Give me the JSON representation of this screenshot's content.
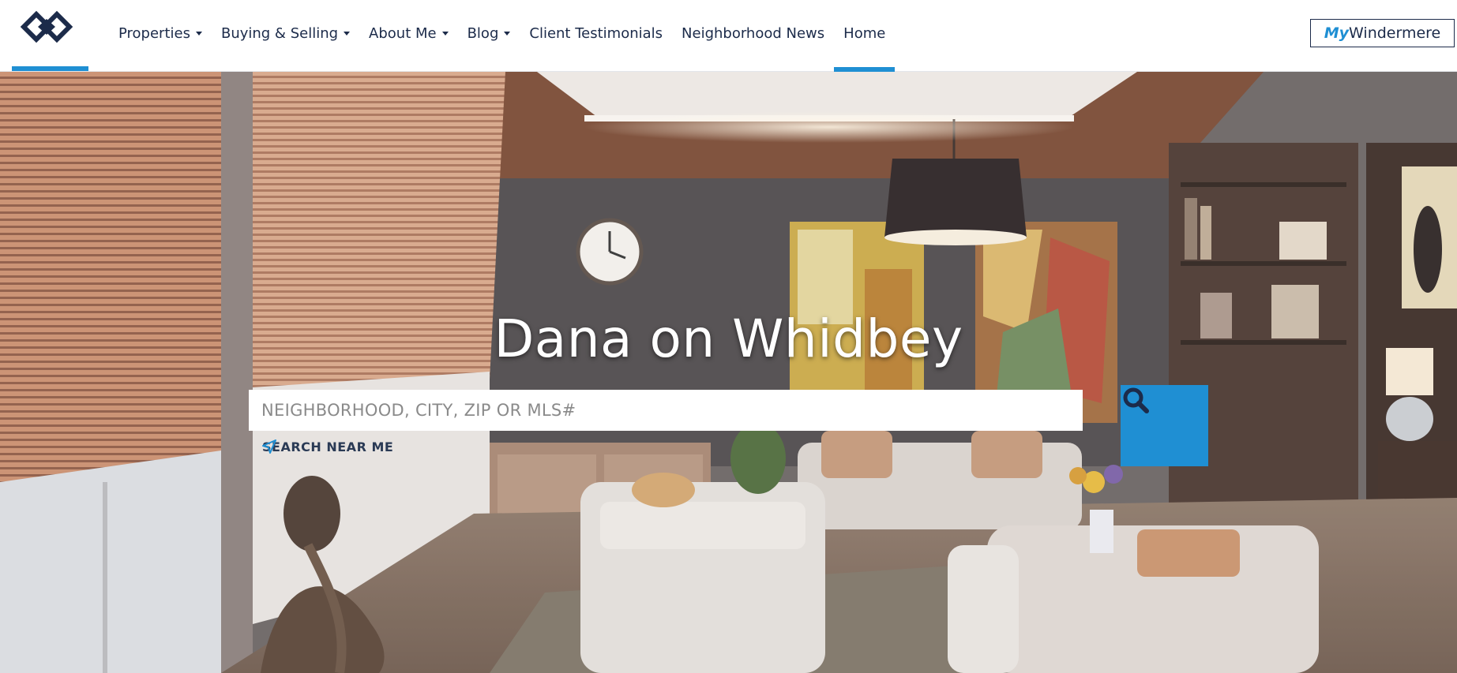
{
  "header": {
    "logo_icon": "windermere-logo-icon",
    "nav": [
      {
        "label": "Properties",
        "dropdown": true
      },
      {
        "label": "Buying & Selling",
        "dropdown": true
      },
      {
        "label": "About Me",
        "dropdown": true
      },
      {
        "label": "Blog",
        "dropdown": true
      },
      {
        "label": "Client Testimonials",
        "dropdown": false
      },
      {
        "label": "Neighborhood News",
        "dropdown": false
      },
      {
        "label": "Home",
        "dropdown": false,
        "active": true
      }
    ],
    "mywindermere": {
      "prefix": "My",
      "suffix": "Windermere"
    }
  },
  "hero": {
    "title": "Dana on Whidbey",
    "search": {
      "placeholder": "NEIGHBORHOOD, CITY, ZIP OR MLS#",
      "value": "",
      "button_icon": "search-icon"
    },
    "near_me": {
      "label": "SEARCH NEAR ME",
      "icon": "location-arrow-icon"
    }
  },
  "colors": {
    "accent": "#1f8fd3",
    "nav_text": "#1c2b4a"
  }
}
